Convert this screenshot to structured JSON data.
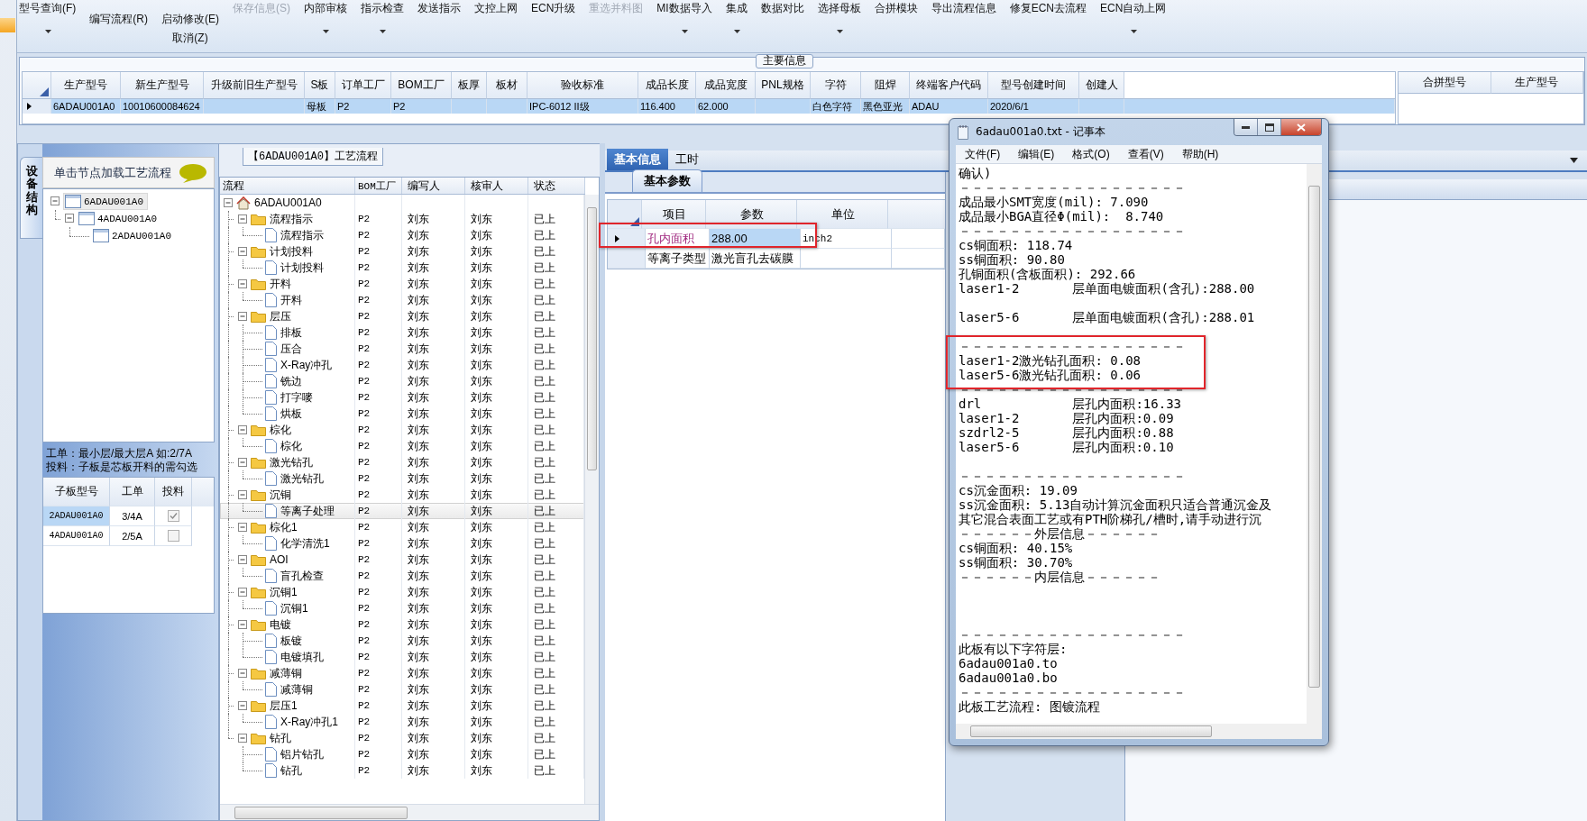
{
  "toolbar": [
    {
      "label": "型号查询(F)",
      "kind": "top",
      "caret": true,
      "disabled": false
    },
    {
      "label": "编写流程(R)",
      "kind": "low",
      "caret": false,
      "disabled": false
    },
    {
      "label": "启动修改(E)",
      "sublabel": "取消(Z)",
      "kind": "low",
      "caret": false,
      "disabled": false
    },
    {
      "label": "保存信息(S)",
      "kind": "top",
      "caret": false,
      "disabled": true
    },
    {
      "label": "内部审核",
      "kind": "top",
      "caret": true,
      "disabled": false
    },
    {
      "label": "指示检查",
      "kind": "top",
      "caret": true,
      "disabled": false
    },
    {
      "label": "发送指示",
      "kind": "top",
      "caret": false,
      "disabled": false
    },
    {
      "label": "文控上网",
      "kind": "top",
      "caret": false,
      "disabled": false
    },
    {
      "label": "ECN升级",
      "kind": "top",
      "caret": false,
      "disabled": false
    },
    {
      "label": "重选并料图",
      "kind": "top",
      "caret": false,
      "disabled": true
    },
    {
      "label": "MI数据导入",
      "kind": "top",
      "caret": true,
      "disabled": false
    },
    {
      "label": "集成",
      "kind": "top",
      "caret": true,
      "disabled": false
    },
    {
      "label": "数据对比",
      "kind": "top",
      "caret": false,
      "disabled": false
    },
    {
      "label": "选择母板",
      "kind": "top",
      "caret": true,
      "disabled": false
    },
    {
      "label": "合拼模块",
      "kind": "top",
      "caret": false,
      "disabled": false
    },
    {
      "label": "导出流程信息",
      "kind": "top",
      "caret": false,
      "disabled": false
    },
    {
      "label": "修复ECN去流程",
      "kind": "top",
      "caret": false,
      "disabled": false
    },
    {
      "label": "ECN自动上网",
      "kind": "top",
      "caret": true,
      "disabled": false
    }
  ],
  "main_info": {
    "title": "主要信息",
    "columns": [
      "生产型号",
      "新生产型号",
      "升级前旧生产型号",
      "S板",
      "订单工厂",
      "BOM工厂",
      "板厚",
      "板材",
      "验收标准",
      "成品长度",
      "成品宽度",
      "PNL规格",
      "字符",
      "阻焊",
      "终端客户代码",
      "型号创建时间",
      "创建人"
    ],
    "rows": [
      {
        "selected": true,
        "cells": [
          "6ADAU001A0",
          "10010600084624",
          "",
          "母板",
          "P2",
          "P2",
          "",
          "",
          "IPC-6012 II级",
          "116.400",
          "62.000",
          "",
          "白色字符",
          "黑色亚光",
          "ADAU",
          "2020/6/1",
          ""
        ]
      }
    ],
    "merge_columns": [
      "合拼型号",
      "生产型号"
    ]
  },
  "structure_panel": {
    "tab": "设备结构",
    "hint": "单击节点加载工艺流程",
    "tree": [
      {
        "label": "6ADAU001A0",
        "expanded": true,
        "selected": true,
        "children": [
          {
            "label": "4ADAU001A0",
            "expanded": true,
            "selected": false,
            "children": [
              {
                "label": "2ADAU001A0",
                "selected": false
              }
            ]
          }
        ]
      }
    ],
    "notes": [
      "工单：最小层/最大层A 如:2/7A",
      "投料：子板是芯板开料的需勾选"
    ],
    "sub_boards": {
      "columns": [
        "子板型号",
        "工单",
        "投料"
      ],
      "rows": [
        {
          "board": "2ADAU001A0",
          "order": "3/4A",
          "feed_checked": true,
          "selected": true
        },
        {
          "board": "4ADAU001A0",
          "order": "2/5A",
          "feed_checked": false,
          "selected": false
        }
      ]
    }
  },
  "flow": {
    "title": "【6ADAU001A0】工艺流程",
    "columns": [
      "流程",
      "BOM工厂",
      "编写人",
      "核审人",
      "状态"
    ],
    "tree": [
      {
        "label": "6ADAU001A0",
        "expanded": true,
        "selected": false,
        "children": [
          {
            "label": "流程指示",
            "bom": "P2",
            "writer": "刘东",
            "reviewer": "刘东",
            "status": "已上",
            "expanded": true,
            "selected": false,
            "children": [
              {
                "label": "流程指示",
                "bom": "P2",
                "writer": "刘东",
                "reviewer": "刘东",
                "status": "已上",
                "selected": false
              }
            ]
          },
          {
            "label": "计划投料",
            "bom": "P2",
            "writer": "刘东",
            "reviewer": "刘东",
            "status": "已上",
            "expanded": true,
            "selected": false,
            "children": [
              {
                "label": "计划投料",
                "bom": "P2",
                "writer": "刘东",
                "reviewer": "刘东",
                "status": "已上",
                "selected": false
              }
            ]
          },
          {
            "label": "开料",
            "bom": "P2",
            "writer": "刘东",
            "reviewer": "刘东",
            "status": "已上",
            "expanded": true,
            "selected": false,
            "children": [
              {
                "label": "开料",
                "bom": "P2",
                "writer": "刘东",
                "reviewer": "刘东",
                "status": "已上",
                "selected": false
              }
            ]
          },
          {
            "label": "层压",
            "bom": "P2",
            "writer": "刘东",
            "reviewer": "刘东",
            "status": "已上",
            "expanded": true,
            "selected": false,
            "children": [
              {
                "label": "排板",
                "bom": "P2",
                "writer": "刘东",
                "reviewer": "刘东",
                "status": "已上",
                "selected": false
              },
              {
                "label": "压合",
                "bom": "P2",
                "writer": "刘东",
                "reviewer": "刘东",
                "status": "已上",
                "selected": false
              },
              {
                "label": "X-Ray冲孔",
                "bom": "P2",
                "writer": "刘东",
                "reviewer": "刘东",
                "status": "已上",
                "selected": false
              },
              {
                "label": "铣边",
                "bom": "P2",
                "writer": "刘东",
                "reviewer": "刘东",
                "status": "已上",
                "selected": false
              },
              {
                "label": "打字嘜",
                "bom": "P2",
                "writer": "刘东",
                "reviewer": "刘东",
                "status": "已上",
                "selected": false
              },
              {
                "label": "烘板",
                "bom": "P2",
                "writer": "刘东",
                "reviewer": "刘东",
                "status": "已上",
                "selected": false
              }
            ]
          },
          {
            "label": "棕化",
            "bom": "P2",
            "writer": "刘东",
            "reviewer": "刘东",
            "status": "已上",
            "expanded": true,
            "selected": false,
            "children": [
              {
                "label": "棕化",
                "bom": "P2",
                "writer": "刘东",
                "reviewer": "刘东",
                "status": "已上",
                "selected": false
              }
            ]
          },
          {
            "label": "激光钻孔",
            "bom": "P2",
            "writer": "刘东",
            "reviewer": "刘东",
            "status": "已上",
            "expanded": true,
            "selected": false,
            "children": [
              {
                "label": "激光钻孔",
                "bom": "P2",
                "writer": "刘东",
                "reviewer": "刘东",
                "status": "已上",
                "selected": false
              }
            ]
          },
          {
            "label": "沉铜",
            "bom": "P2",
            "writer": "刘东",
            "reviewer": "刘东",
            "status": "已上",
            "expanded": true,
            "selected": false,
            "children": [
              {
                "label": "等离子处理",
                "bom": "P2",
                "writer": "刘东",
                "reviewer": "刘东",
                "status": "已上",
                "selected": true
              }
            ]
          },
          {
            "label": "棕化1",
            "bom": "P2",
            "writer": "刘东",
            "reviewer": "刘东",
            "status": "已上",
            "expanded": true,
            "selected": false,
            "children": [
              {
                "label": "化学清洗1",
                "bom": "P2",
                "writer": "刘东",
                "reviewer": "刘东",
                "status": "已上",
                "selected": false
              }
            ]
          },
          {
            "label": "AOI",
            "bom": "P2",
            "writer": "刘东",
            "reviewer": "刘东",
            "status": "已上",
            "expanded": true,
            "selected": false,
            "children": [
              {
                "label": "盲孔检查",
                "bom": "P2",
                "writer": "刘东",
                "reviewer": "刘东",
                "status": "已上",
                "selected": false
              }
            ]
          },
          {
            "label": "沉铜1",
            "bom": "P2",
            "writer": "刘东",
            "reviewer": "刘东",
            "status": "已上",
            "expanded": true,
            "selected": false,
            "children": [
              {
                "label": "沉铜1",
                "bom": "P2",
                "writer": "刘东",
                "reviewer": "刘东",
                "status": "已上",
                "selected": false
              }
            ]
          },
          {
            "label": "电镀",
            "bom": "P2",
            "writer": "刘东",
            "reviewer": "刘东",
            "status": "已上",
            "expanded": true,
            "selected": false,
            "children": [
              {
                "label": "板镀",
                "bom": "P2",
                "writer": "刘东",
                "reviewer": "刘东",
                "status": "已上",
                "selected": false
              },
              {
                "label": "电镀填孔",
                "bom": "P2",
                "writer": "刘东",
                "reviewer": "刘东",
                "status": "已上",
                "selected": false
              }
            ]
          },
          {
            "label": "减薄铜",
            "bom": "P2",
            "writer": "刘东",
            "reviewer": "刘东",
            "status": "已上",
            "expanded": true,
            "selected": false,
            "children": [
              {
                "label": "减薄铜",
                "bom": "P2",
                "writer": "刘东",
                "reviewer": "刘东",
                "status": "已上",
                "selected": false
              }
            ]
          },
          {
            "label": "层压1",
            "bom": "P2",
            "writer": "刘东",
            "reviewer": "刘东",
            "status": "已上",
            "expanded": true,
            "selected": false,
            "children": [
              {
                "label": "X-Ray冲孔1",
                "bom": "P2",
                "writer": "刘东",
                "reviewer": "刘东",
                "status": "已上",
                "selected": false
              }
            ]
          },
          {
            "label": "钻孔",
            "bom": "P2",
            "writer": "刘东",
            "reviewer": "刘东",
            "status": "已上",
            "expanded": true,
            "selected": false,
            "children": [
              {
                "label": "铝片钻孔",
                "bom": "P2",
                "writer": "刘东",
                "reviewer": "刘东",
                "status": "已上",
                "selected": false
              },
              {
                "label": "钻孔",
                "bom": "P2",
                "writer": "刘东",
                "reviewer": "刘东",
                "status": "已上",
                "selected": false
              }
            ]
          }
        ]
      }
    ]
  },
  "detail": {
    "tabs": [
      {
        "label": "基本信息",
        "selected": true
      },
      {
        "label": "工时",
        "selected": false
      }
    ],
    "subtab": "基本参数",
    "columns": [
      "项目",
      "参数",
      "单位"
    ],
    "rows": [
      {
        "item": "孔内面积",
        "value": "288.00",
        "unit": "inch2",
        "flagged": true,
        "selected": true
      },
      {
        "item": "等离子类型",
        "value": "激光盲孔去碳膜",
        "flagged": false,
        "selected": false
      }
    ]
  },
  "notepad": {
    "title": "6adau001a0.txt - 记事本",
    "menu": [
      "文件(F)",
      "编辑(E)",
      "格式(O)",
      "查看(V)",
      "帮助(H)"
    ],
    "lines": [
      {
        "kind": "text",
        "text": "确认)"
      },
      {
        "kind": "text",
        "text": "－－－－－－－－－－－－－－－－－－"
      },
      {
        "kind": "text",
        "text": "成品最小SMT宽度(mil): 7.090"
      },
      {
        "kind": "text",
        "text": "成品最小BGA直径Φ(mil):  8.740"
      },
      {
        "kind": "text",
        "text": "－－－－－－－－－－－－－－－－－－"
      },
      {
        "kind": "text",
        "text": "cs铜面积: 118.74"
      },
      {
        "kind": "text",
        "text": "ss铜面积: 90.80"
      },
      {
        "kind": "text",
        "text": "孔铜面积(含板面积): 292.66"
      },
      {
        "kind": "text",
        "text": "laser1-2       层单面电镀面积(含孔):288.00"
      },
      {
        "kind": "blank"
      },
      {
        "kind": "text",
        "text": "laser5-6       层单面电镀面积(含孔):288.01"
      },
      {
        "kind": "blank"
      },
      {
        "kind": "text",
        "text": "－－－－－－－－－－－－－－－－－－"
      },
      {
        "kind": "text",
        "text": "laser1-2激光钻孔面积: 0.08"
      },
      {
        "kind": "text",
        "text": "laser5-6激光钻孔面积: 0.06"
      },
      {
        "kind": "text",
        "text": "－－－－－－－－－－－－－－－－－－"
      },
      {
        "kind": "text",
        "text": "drl            层孔内面积:16.33"
      },
      {
        "kind": "text",
        "text": "laser1-2       层孔内面积:0.09"
      },
      {
        "kind": "text",
        "text": "szdrl2-5       层孔内面积:0.88"
      },
      {
        "kind": "text",
        "text": "laser5-6       层孔内面积:0.10"
      },
      {
        "kind": "blank"
      },
      {
        "kind": "text",
        "text": "－－－－－－－－－－－－－－－－－－"
      },
      {
        "kind": "text",
        "text": "cs沉金面积: 19.09"
      },
      {
        "kind": "text",
        "text": "ss沉金面积: 5.13自动计算沉金面积只适合普通沉金及"
      },
      {
        "kind": "text",
        "text": "其它混合表面工艺或有PTH阶梯孔/槽时,请手动进行沉"
      },
      {
        "kind": "text",
        "text": "－－－－－－外层信息－－－－－－"
      },
      {
        "kind": "text",
        "text": "cs铜面积: 40.15%"
      },
      {
        "kind": "text",
        "text": "ss铜面积: 30.70%"
      },
      {
        "kind": "text",
        "text": "－－－－－－内层信息－－－－－－"
      },
      {
        "kind": "blank"
      },
      {
        "kind": "blank"
      },
      {
        "kind": "blank"
      },
      {
        "kind": "text",
        "text": "－－－－－－－－－－－－－－－－－－"
      },
      {
        "kind": "text",
        "text": "此板有以下字符层:"
      },
      {
        "kind": "text",
        "text": "6adau001a0.to"
      },
      {
        "kind": "text",
        "text": "6adau001a0.bo"
      },
      {
        "kind": "text",
        "text": "－－－－－－－－－－－－－－－－－－"
      },
      {
        "kind": "text",
        "text": "此板工艺流程: 图镀流程"
      }
    ]
  }
}
